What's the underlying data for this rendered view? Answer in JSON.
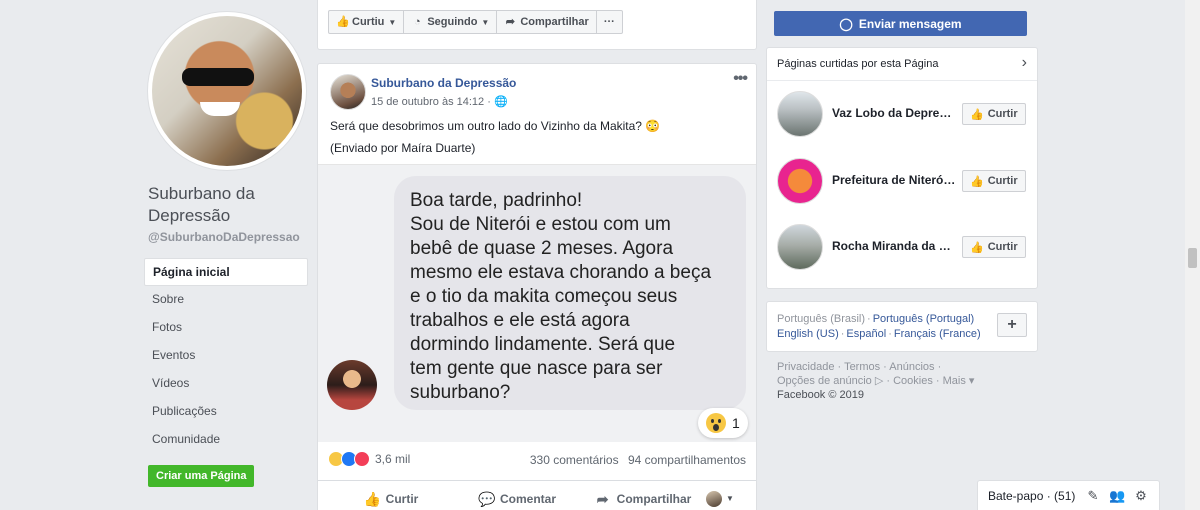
{
  "page": {
    "name": "Suburbano da Depressão",
    "handle": "@SuburbanoDaDepressao"
  },
  "nav": {
    "items": [
      {
        "label": "Página inicial",
        "active": true
      },
      {
        "label": "Sobre"
      },
      {
        "label": "Fotos"
      },
      {
        "label": "Eventos"
      },
      {
        "label": "Vídeos"
      },
      {
        "label": "Publicações"
      },
      {
        "label": "Comunidade"
      }
    ],
    "create_page": "Criar uma Página"
  },
  "action_bar": {
    "like": "Curtiu",
    "follow": "Seguindo",
    "share": "Compartilhar",
    "more": "···"
  },
  "message_button": "Enviar mensagem",
  "post": {
    "author": "Suburbano da Depressão",
    "date": "15 de outubro às 14:12 · ",
    "text": "Será que desobrimos um outro lado do Vizinho da Makita? 😳",
    "sub": "(Enviado por Maíra Duarte)",
    "bubble_lines": [
      "Boa tarde, padrinho!",
      "Sou de Niterói e estou com um",
      "bebê de quase 2 meses. Agora",
      "mesmo ele estava chorando a beça",
      "e o tio da makita começou seus",
      "trabalhos e ele está agora",
      "dormindo lindamente. Será que",
      "tem gente que nasce para ser",
      "suburbano?"
    ],
    "bubble_reaction_count": "1",
    "reactions_count": "3,6 mil",
    "comments": "330 comentários",
    "shares": "94 compartilhamentos",
    "actions": {
      "like": "Curtir",
      "comment": "Comentar",
      "share": "Compartilhar"
    }
  },
  "liked_pages": {
    "title": "Páginas curtidas por esta Página",
    "button": "Curtir",
    "items": [
      {
        "name": "Vaz Lobo da Depres...",
        "verified": false
      },
      {
        "name": "Prefeitura de Niterói",
        "verified": true
      },
      {
        "name": "Rocha Miranda da D...",
        "verified": false
      }
    ]
  },
  "languages": {
    "current": "Português (Brasil)",
    "others_line1": [
      "Português (Portugal)"
    ],
    "others_line2": [
      "English (US)",
      "Español",
      "Français (France)"
    ],
    "add": "+"
  },
  "footer": {
    "line1": [
      "Privacidade",
      "Termos",
      "Anúncios"
    ],
    "line2": [
      "Opções de anúncio ▷",
      "Cookies",
      "Mais ▾"
    ],
    "copyright": "Facebook © 2019"
  },
  "chat": {
    "label": "Bate-papo · (51)"
  },
  "colors": {
    "brand_blue": "#4267b2",
    "link_blue": "#365899",
    "create_green": "#42b72a",
    "background": "#e9ebee"
  }
}
